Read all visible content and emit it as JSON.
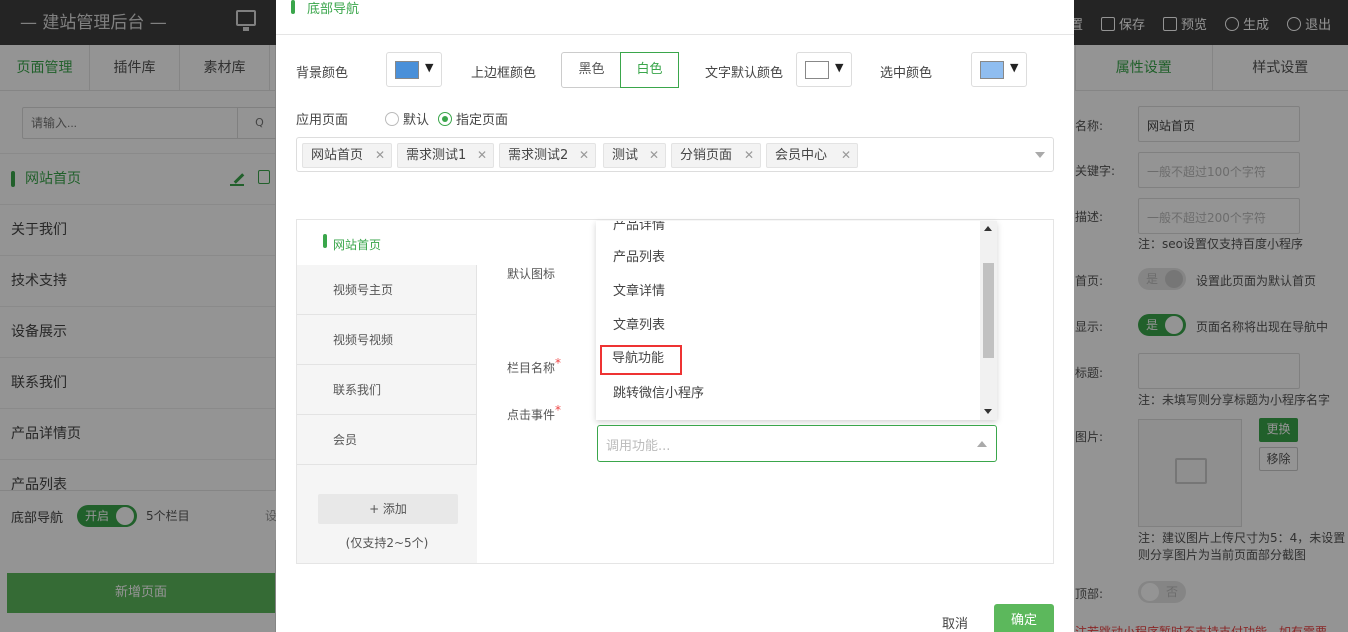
{
  "app": {
    "title": "— 建站管理后台 —"
  },
  "toolbar": {
    "settings": "置",
    "save": "保存",
    "preview": "预览",
    "generate": "生成",
    "exit": "退出"
  },
  "left": {
    "tabs": [
      "页面管理",
      "插件库",
      "素材库"
    ],
    "search_placeholder": "请输入...",
    "search_button": "Q",
    "pages": [
      "网站首页",
      "关于我们",
      "技术支持",
      "设备展示",
      "联系我们",
      "产品详情页",
      "产品列表"
    ],
    "footer": {
      "label": "底部导航",
      "toggle": "开启",
      "count": "5个栏目",
      "extra": "设"
    },
    "new_page": "新增页面"
  },
  "right": {
    "tabs": [
      "属性设置",
      "样式设置"
    ],
    "name_label": "名称:",
    "name_value": "网站首页",
    "keyword_label": "关键字:",
    "keyword_placeholder": "一般不超过100个字符",
    "desc_label": "描述:",
    "desc_placeholder": "一般不超过200个字符",
    "seo_note": "注：seo设置仅支持百度小程序",
    "home_label": "首页:",
    "home_toggle": "是",
    "home_note": "设置此页面为默认首页",
    "show_label": "显示:",
    "show_toggle": "是",
    "show_note": "页面名称将出现在导航中",
    "share_title_label": "标题:",
    "share_note": "注：未填写则分享标题为小程序名字",
    "image_label": "图片:",
    "replace": "更换",
    "remove": "移除",
    "image_note": "注：建议图片上传尺寸为5：4，未设置则分享图片为当前页面部分截图",
    "bottom_label": "顶部:",
    "bottom_toggle": "否",
    "warning": "注若跳动小程序暂时不支持支付功能，如有需要"
  },
  "modal": {
    "title": "底部导航",
    "bg_color_label": "背景颜色",
    "border_color_label": "上边框颜色",
    "border_options": [
      "黑色",
      "白色"
    ],
    "border_selected": "白色",
    "text_color_label": "文字默认颜色",
    "selected_color_label": "选中颜色",
    "colors": {
      "bg": "#4a90d9",
      "text": "#ffffff",
      "selected": "#8fbdf0",
      "accent": "#3aa64b"
    },
    "apply_label": "应用页面",
    "apply_options": [
      "默认",
      "指定页面"
    ],
    "apply_selected": "指定页面",
    "tags": [
      "网站首页",
      "需求测试1",
      "需求测试2",
      "测试",
      "分销页面",
      "会员中心"
    ],
    "nav_items": [
      "网站首页",
      "视频号主页",
      "视频号视频",
      "联系我们",
      "会员"
    ],
    "add_button": "+ 添加",
    "add_note": "(仅支持2~5个)",
    "default_icon_label": "默认图标",
    "column_name_label": "栏目名称",
    "click_event_label": "点击事件",
    "dropdown_items": [
      "产品详情",
      "产品列表",
      "文章详情",
      "文章列表",
      "导航功能",
      "跳转微信小程序"
    ],
    "dropdown_highlight": "导航功能",
    "select_placeholder": "调用功能...",
    "cancel": "取消",
    "ok": "确定"
  }
}
